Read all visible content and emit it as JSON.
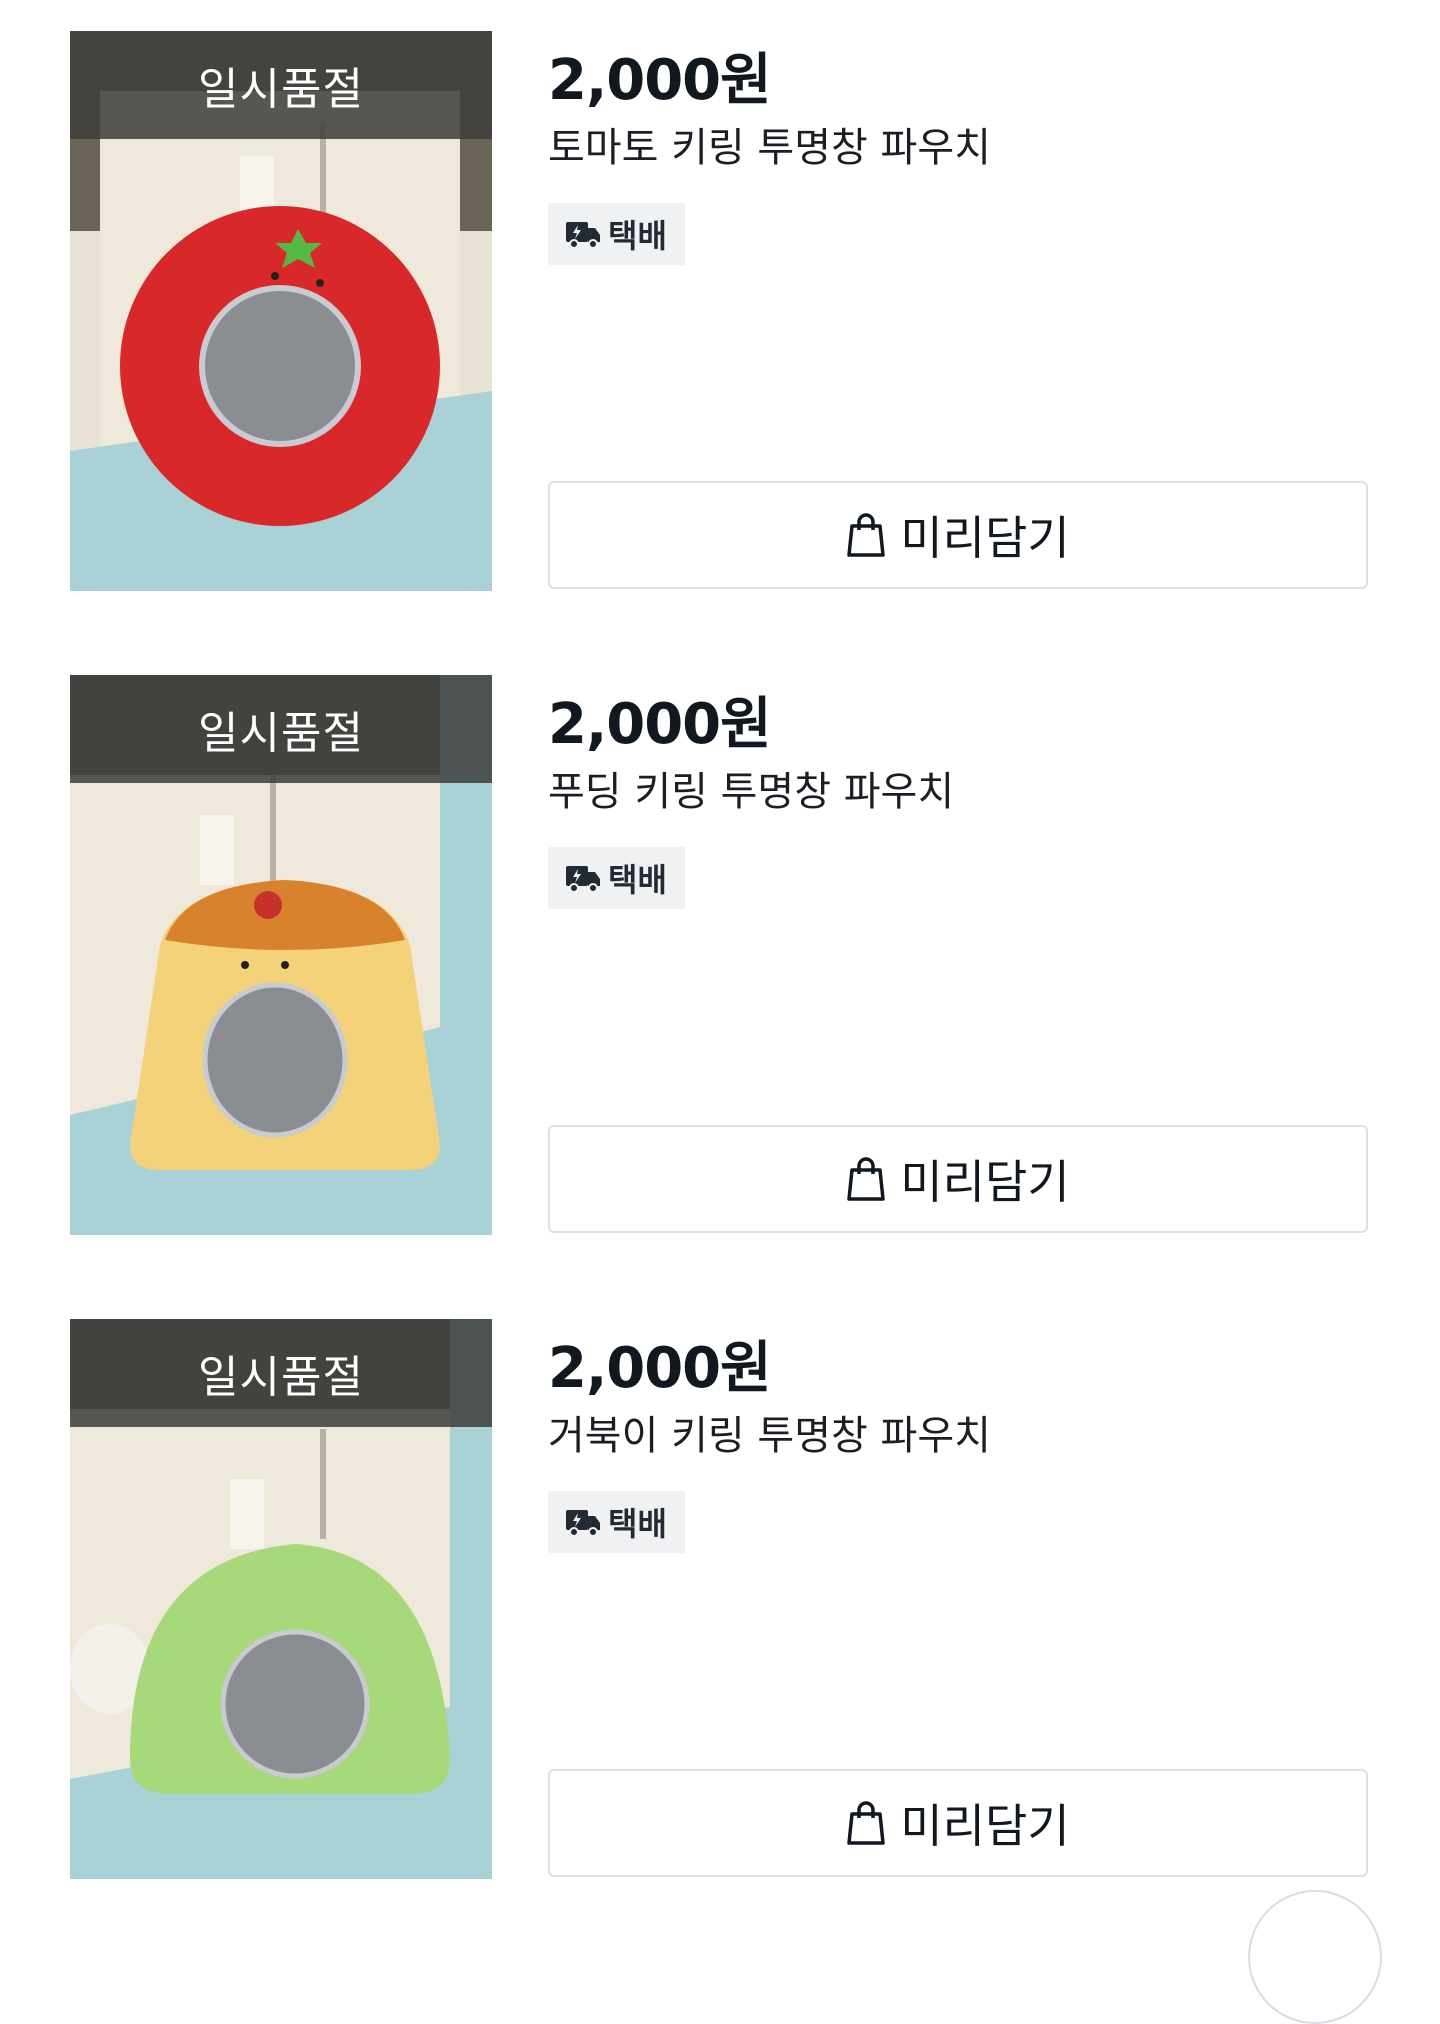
{
  "colors": {
    "soldout_overlay": "#3e3e3c",
    "badge_bg": "#eff1f3",
    "text": "#111820",
    "border": "#dcdfe3"
  },
  "products": [
    {
      "soldout_label": "일시품절",
      "price": "2,000원",
      "name": "토마토 키링 투명창 파우치",
      "delivery_badge": "택배",
      "cart_label": "미리담기",
      "image_desc_icon": "tomato-pouch-image",
      "pouch_color": "#d8282a"
    },
    {
      "soldout_label": "일시품절",
      "price": "2,000원",
      "name": "푸딩 키링 투명창 파우치",
      "delivery_badge": "택배",
      "cart_label": "미리담기",
      "image_desc_icon": "pudding-pouch-image",
      "pouch_color": "#f3d27a"
    },
    {
      "soldout_label": "일시품절",
      "price": "2,000원",
      "name": "거북이 키링 투명창 파우치",
      "delivery_badge": "택배",
      "cart_label": "미리담기",
      "image_desc_icon": "turtle-pouch-image",
      "pouch_color": "#a7d87a"
    }
  ]
}
